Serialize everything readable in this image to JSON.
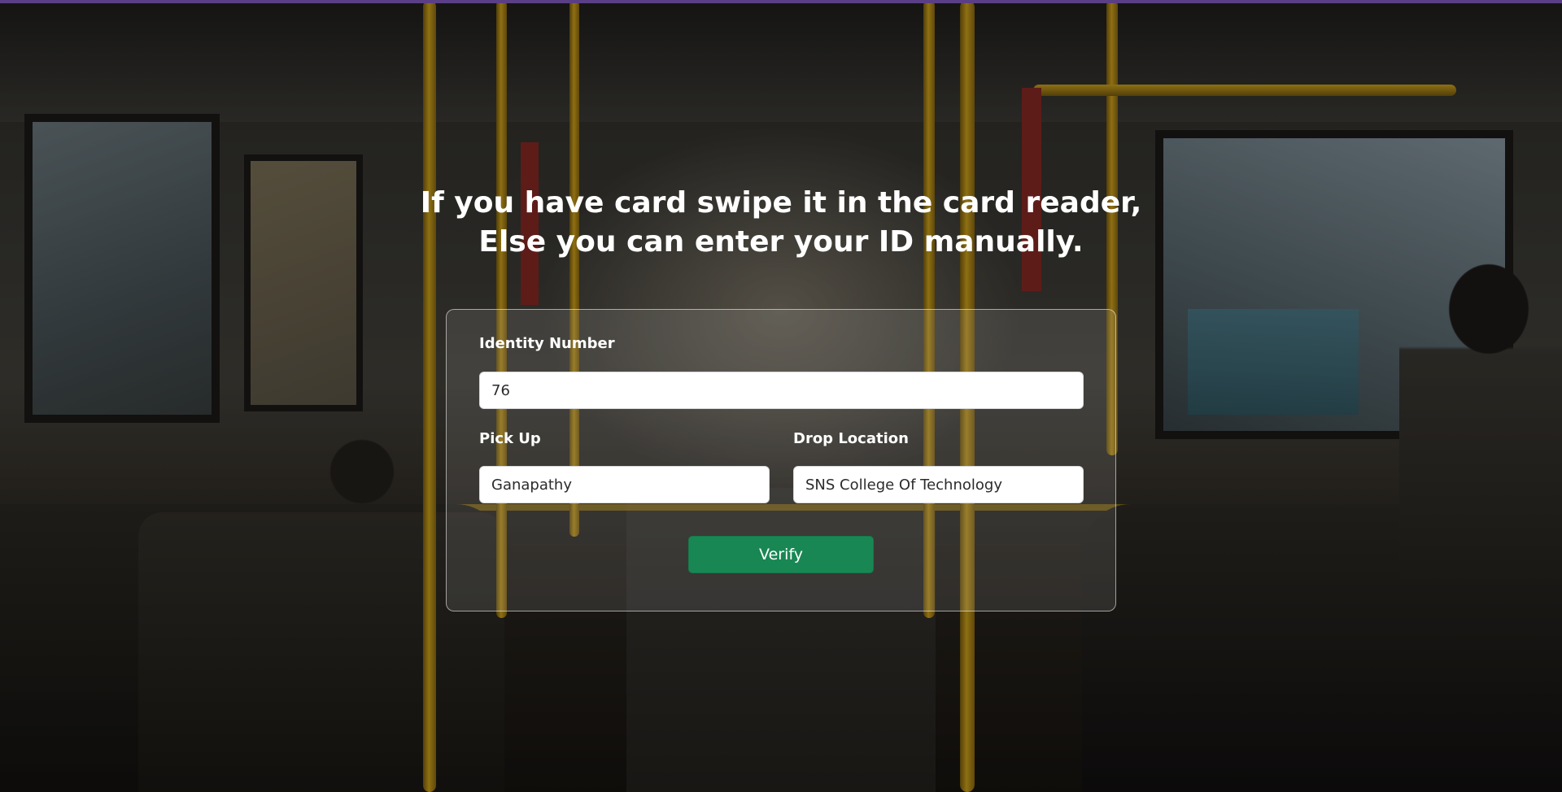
{
  "heading": {
    "line1": "If you have card swipe it in the card reader,",
    "line2": "Else you can enter your ID manually."
  },
  "form": {
    "identity": {
      "label": "Identity Number",
      "value": "76"
    },
    "pickup": {
      "label": "Pick Up",
      "value": "Ganapathy"
    },
    "drop": {
      "label": "Drop Location",
      "value": "SNS College Of Technology"
    },
    "verify_label": "Verify"
  },
  "colors": {
    "accent": "#198754",
    "top_strip": "#5b3f86"
  }
}
